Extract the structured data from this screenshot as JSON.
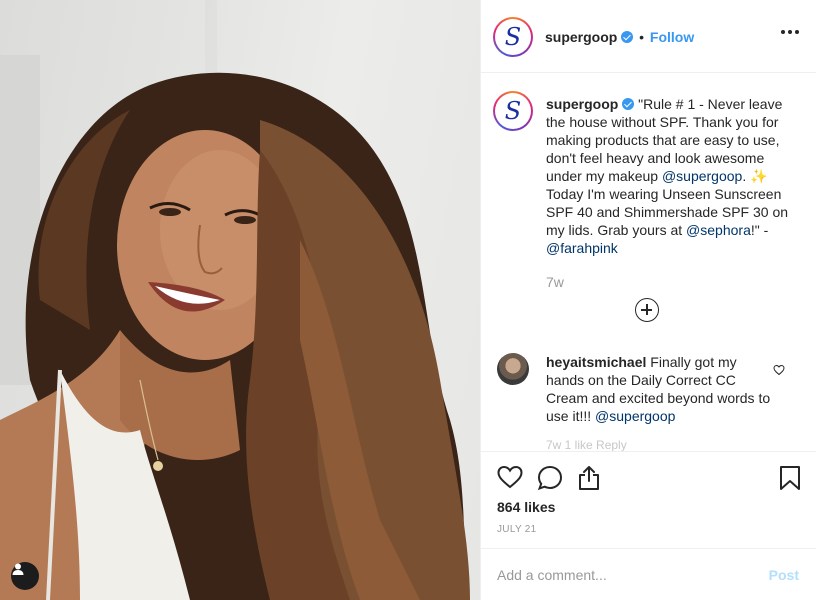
{
  "header": {
    "avatar_letter": "S",
    "username": "supergoop",
    "separator": "•",
    "follow_label": "Follow"
  },
  "caption": {
    "username": "supergoop",
    "text_1": "\"Rule # 1 - Never leave the house without SPF. Thank you for making products that are easy to use, don't feel heavy and look awesome under my makeup ",
    "mention_1": "@supergoop",
    "text_2": ". ✨ Today I'm wearing Unseen Sunscreen SPF 40 and Shimmershade SPF 30 on my lids. Grab yours at ",
    "mention_2": "@sephora",
    "text_3": "!\" - ",
    "mention_3": "@farahpink",
    "time": "7w"
  },
  "comment": {
    "username": "heyaitsmichael",
    "text": " Finally got my hands on the Daily Correct CC Cream and excited beyond words to use it!!! ",
    "mention": "@supergoop",
    "meta_faded": "7w  1 like  Reply"
  },
  "actions": {
    "likes": "864 likes",
    "date": "JULY 21"
  },
  "add_comment": {
    "placeholder": "Add a comment...",
    "post_label": "Post"
  },
  "colors": {
    "link": "#003569",
    "follow": "#3897f0",
    "verified": "#3897f0",
    "post_disabled": "#b2dffc"
  },
  "icons": [
    "user-tag-icon",
    "verified-badge-icon",
    "more-options-icon",
    "load-more-comments-icon",
    "heart-icon",
    "comment-icon",
    "share-icon",
    "bookmark-icon"
  ]
}
